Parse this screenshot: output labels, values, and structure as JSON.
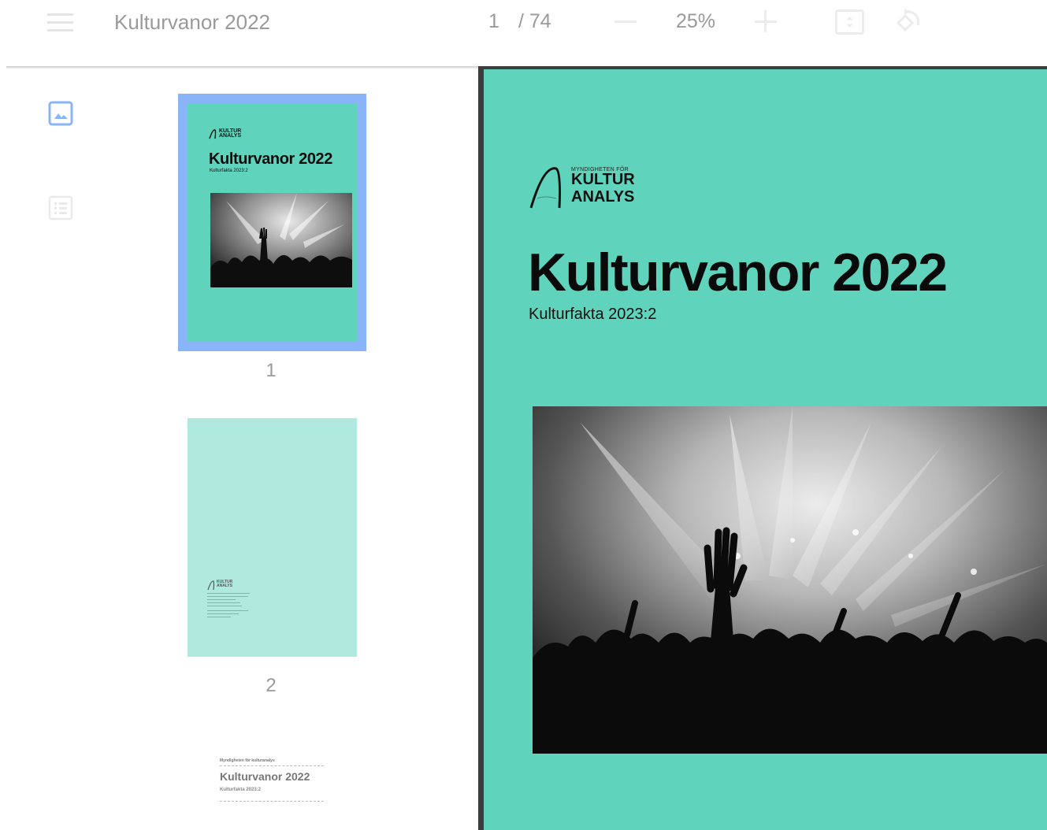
{
  "toolbar": {
    "title": "Kulturvanor 2022",
    "page_current": "1",
    "page_total": "/ 74",
    "zoom": "25%"
  },
  "icons": {
    "menu": "hamburger-menu-icon",
    "zoom_out": "minus-icon",
    "zoom_in": "plus-icon",
    "fit": "fit-to-page-icon",
    "rotate": "rotate-icon",
    "thumbnails": "image-icon",
    "outline": "list-icon"
  },
  "thumbnails": [
    {
      "label": "1",
      "selected": true
    },
    {
      "label": "2",
      "selected": false
    }
  ],
  "cover": {
    "logo_agency": "MYNDIGHETEN FÖR",
    "logo_line1": "KULTUR",
    "logo_line2": "ANALYS",
    "title": "Kulturvanor 2022",
    "subtitle": "Kulturfakta 2023:2"
  },
  "thumb3": {
    "agency": "Myndigheten för kulturanalys",
    "title": "Kulturvanor 2022",
    "subtitle": "Kulturfakta 2023:2"
  },
  "colors": {
    "cover_bg": "#5fd3bb",
    "selection": "#8ab4f8",
    "page2_bg": "#b0e9dd",
    "viewer_border": "#3d3d3d"
  }
}
